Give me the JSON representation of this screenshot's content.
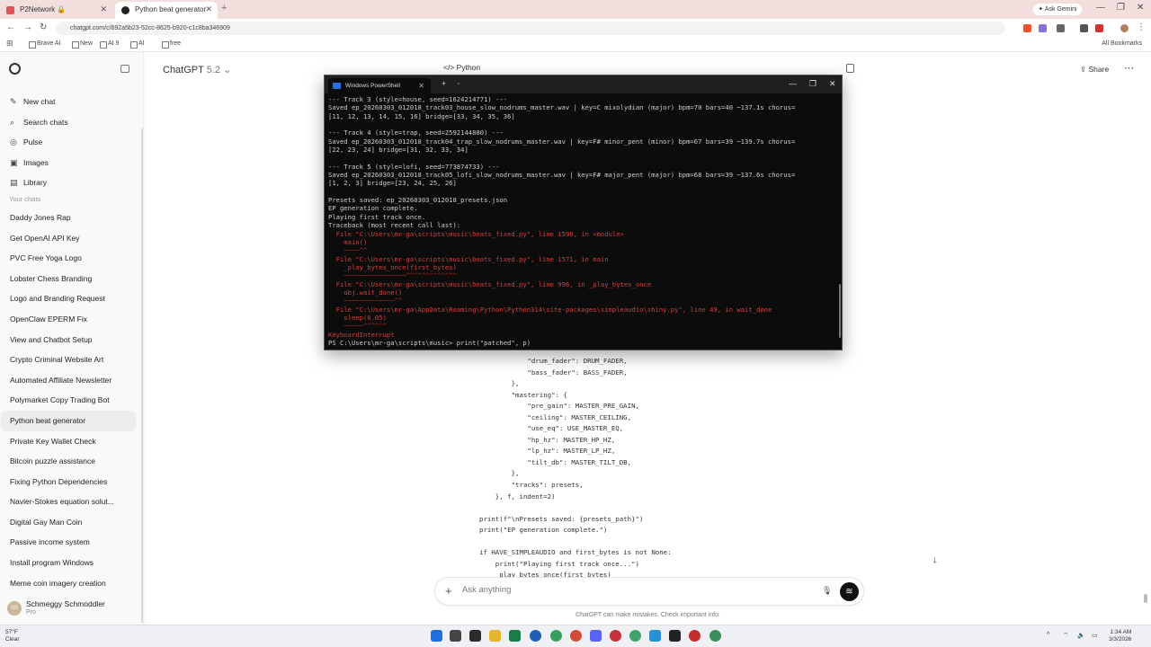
{
  "browser": {
    "tabs": [
      {
        "label": "P2Network 🔒",
        "active": false
      },
      {
        "label": "Python beat generator",
        "active": true
      }
    ],
    "new_tab": "+",
    "ask_gemini": "✦ Ask Gemini",
    "url": "chatgpt.com/c/692a5b23-52cc-8625-b920-c1c8ba346909",
    "bookmarks": [
      "Brave AI",
      "New",
      "AI 9",
      "AI",
      "free"
    ],
    "all_bookmarks": "All Bookmarks",
    "window_controls": {
      "minimize": "—",
      "maximize": "❐",
      "close": "✕"
    }
  },
  "sidebar": {
    "nav": [
      {
        "label": "New chat",
        "icon": "✎"
      },
      {
        "label": "Search chats",
        "icon": "⌕"
      },
      {
        "label": "Pulse",
        "icon": "◎"
      },
      {
        "label": "Images",
        "icon": "▣"
      },
      {
        "label": "Library",
        "icon": "▤"
      }
    ],
    "section_label": "Your chats",
    "chats": [
      "Daddy Jones Rap",
      "Get OpenAI API Key",
      "PVC Free Yoga Logo",
      "Lobster Chess Branding",
      "Logo and Branding Request",
      "OpenClaw EPERM Fix",
      "View and Chatbot Setup",
      "Crypto Criminal Website Art",
      "Automated Affiliate Newsletter",
      "Polymarket Copy Trading Bot",
      "Python beat generator",
      "Private Key Wallet Check",
      "Bitcoin puzzle assistance",
      "Fixing Python Dependencies",
      "Navier-Stokes equation solut...",
      "Digital Gay Man Coin",
      "Passive income system",
      "Install program Windows",
      "Meme coin imagery creation"
    ],
    "active_chat": "Python beat generator",
    "user": {
      "name": "Schmeggy Schmoddler",
      "plan": "Pro",
      "initials": "SS"
    }
  },
  "main": {
    "model_name": "ChatGPT",
    "model_version": "5.2 ⌄",
    "share_label": "⇪ Share",
    "more_label": "⋯",
    "code_language": "Python",
    "code_lines": [
      "            \"drum_fader\": DRUM_FADER,",
      "            \"bass_fader\": BASS_FADER,",
      "        },",
      "        \"mastering\": {",
      "            \"pre_gain\": MASTER_PRE_GAIN,",
      "            \"ceiling\": MASTER_CEILING,",
      "            \"use_eq\": USE_MASTER_EQ,",
      "            \"hp_hz\": MASTER_HP_HZ,",
      "            \"lp_hz\": MASTER_LP_HZ,",
      "            \"tilt_db\": MASTER_TILT_DB,",
      "        },",
      "        \"tracks\": presets,",
      "    }, f, indent=2)",
      "",
      "print(f\"\\nPresets saved: {presets_path}\")",
      "print(\"EP generation complete.\")",
      "",
      "if HAVE_SIMPLEAUDIO and first_bytes is not None:",
      "    print(\"Playing first track once...\")",
      "    _play_bytes_once(first_bytes)"
    ],
    "composer_placeholder": "Ask anything",
    "disclaimer": "ChatGPT can make mistakes. Check important info."
  },
  "terminal": {
    "tab_title": "Windows PowerShell",
    "lines": [
      {
        "t": "--- Track 3 (style=house, seed=1624214771) ---",
        "c": ""
      },
      {
        "t": "Saved ep_20260303_012018_track03_house_slow_nodrums_master.wav | key=C mixolydian (major) bpm=70 bars=40 ~137.1s chorus=",
        "c": ""
      },
      {
        "t": "[11, 12, 13, 14, 15, 16] bridge=[33, 34, 35, 36]",
        "c": ""
      },
      {
        "t": "",
        "c": ""
      },
      {
        "t": "--- Track 4 (style=trap, seed=2592144880) ---",
        "c": ""
      },
      {
        "t": "Saved ep_20260303_012018_track04_trap_slow_nodrums_master.wav | key=F# minor_pent (minor) bpm=67 bars=39 ~139.7s chorus=",
        "c": ""
      },
      {
        "t": "[22, 23, 24] bridge=[31, 32, 33, 34]",
        "c": ""
      },
      {
        "t": "",
        "c": ""
      },
      {
        "t": "--- Track 5 (style=lofi, seed=773874733) ---",
        "c": ""
      },
      {
        "t": "Saved ep_20260303_012018_track05_lofi_slow_nodrums_master.wav | key=F# major_pent (major) bpm=68 bars=39 ~137.6s chorus=",
        "c": ""
      },
      {
        "t": "[1, 2, 3] bridge=[23, 24, 25, 26]",
        "c": ""
      },
      {
        "t": "",
        "c": ""
      },
      {
        "t": "Presets saved: ep_20260303_012018_presets.json",
        "c": ""
      },
      {
        "t": "EP generation complete.",
        "c": ""
      },
      {
        "t": "Playing first track once.",
        "c": ""
      },
      {
        "t": "Traceback (most recent call last):",
        "c": ""
      },
      {
        "t": "  File \"C:\\Users\\mr-ga\\scripts\\music\\beats_fixed.py\", line 1598, in <module>",
        "c": "err"
      },
      {
        "t": "    main()",
        "c": "err"
      },
      {
        "t": "    ~~~~^^",
        "c": "wv"
      },
      {
        "t": "  File \"C:\\Users\\mr-ga\\scripts\\music\\beats_fixed.py\", line 1571, in main",
        "c": "err"
      },
      {
        "t": "    _play_bytes_once(first_bytes)",
        "c": "err"
      },
      {
        "t": "    ~~~~~~~~~~~~~~~~^^^^^^^^^^^^^",
        "c": "wv"
      },
      {
        "t": "  File \"C:\\Users\\mr-ga\\scripts\\music\\beats_fixed.py\", line 996, in _play_bytes_once",
        "c": "err"
      },
      {
        "t": "    obj.wait_done()",
        "c": "err"
      },
      {
        "t": "    ~~~~~~~~~~~~~^^",
        "c": "wv"
      },
      {
        "t": "  File \"C:\\Users\\mr-ga\\AppData\\Roaming\\Python\\Python314\\site-packages\\simpleaudio\\shiny.py\", line 49, in wait_done",
        "c": "err"
      },
      {
        "t": "    sleep(0.05)",
        "c": "err"
      },
      {
        "t": "    ~~~~~^^^^^^",
        "c": "wv"
      },
      {
        "t": "KeyboardInterrupt",
        "c": "err"
      },
      {
        "t": "PS C:\\Users\\mr-ga\\scripts\\music> print(\"patched\", p)",
        "c": ""
      }
    ]
  },
  "taskbar": {
    "weather_temp": "57°F",
    "weather_desc": "Clear",
    "tray": "^",
    "time": "1:34 AM",
    "date": "3/3/2026"
  },
  "colors": {
    "tabstrip": "#f3dede",
    "terminal_bg": "#0c0c0c",
    "error_text": "#d04040",
    "voice_button": "#111111"
  }
}
